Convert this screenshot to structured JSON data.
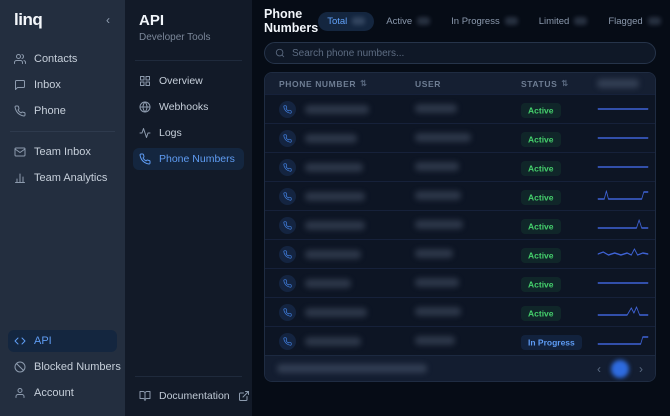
{
  "brand": {
    "logo": "linq"
  },
  "icons": {
    "collapse": "‹",
    "sort": "⇅",
    "prev": "‹",
    "next": "›"
  },
  "left_sidebar": {
    "items": [
      {
        "label": "Contacts"
      },
      {
        "label": "Inbox"
      },
      {
        "label": "Phone"
      }
    ],
    "team_items": [
      {
        "label": "Team Inbox"
      },
      {
        "label": "Team Analytics"
      }
    ],
    "bottom_items": [
      {
        "label": "API",
        "active": true
      },
      {
        "label": "Blocked Numbers"
      },
      {
        "label": "Account"
      }
    ]
  },
  "sub_sidebar": {
    "title": "API",
    "subtitle": "Developer Tools",
    "items": [
      {
        "label": "Overview"
      },
      {
        "label": "Webhooks"
      },
      {
        "label": "Logs"
      },
      {
        "label": "Phone Numbers",
        "active": true
      }
    ],
    "footer": {
      "label": "Documentation"
    }
  },
  "main": {
    "title": "Phone Numbers",
    "tabs": [
      {
        "label": "Total",
        "active": true
      },
      {
        "label": "Active",
        "active": false
      },
      {
        "label": "In Progress",
        "active": false
      },
      {
        "label": "Limited",
        "active": false
      },
      {
        "label": "Flagged",
        "active": false
      }
    ],
    "search": {
      "placeholder": "Search phone numbers..."
    },
    "table": {
      "columns": [
        {
          "label": "PHONE NUMBER",
          "sortable": true
        },
        {
          "label": "USER",
          "sortable": false
        },
        {
          "label": "STATUS",
          "sortable": true
        },
        {
          "label": "",
          "redacted": true
        }
      ],
      "rows": [
        {
          "status": "Active",
          "spark": [
            [
              2,
              8
            ],
            [
              98,
              8
            ]
          ],
          "pw": 64,
          "uw": 42
        },
        {
          "status": "Active",
          "spark": [
            [
              2,
              8
            ],
            [
              98,
              8
            ]
          ],
          "pw": 52,
          "uw": 56
        },
        {
          "status": "Active",
          "spark": [
            [
              2,
              8
            ],
            [
              98,
              8
            ]
          ],
          "pw": 58,
          "uw": 44
        },
        {
          "status": "Active",
          "spark": [
            [
              2,
              11
            ],
            [
              14,
              11
            ],
            [
              18,
              3
            ],
            [
              22,
              11
            ],
            [
              86,
              11
            ],
            [
              90,
              4
            ],
            [
              98,
              4
            ]
          ],
          "pw": 60,
          "uw": 46
        },
        {
          "status": "Active",
          "spark": [
            [
              2,
              11
            ],
            [
              76,
              11
            ],
            [
              81,
              3
            ],
            [
              86,
              11
            ],
            [
              98,
              11
            ]
          ],
          "pw": 60,
          "uw": 48
        },
        {
          "status": "Active",
          "spark": [
            [
              2,
              8
            ],
            [
              12,
              6
            ],
            [
              22,
              9
            ],
            [
              34,
              7
            ],
            [
              46,
              9
            ],
            [
              58,
              7
            ],
            [
              66,
              9
            ],
            [
              72,
              3
            ],
            [
              78,
              9
            ],
            [
              88,
              7
            ],
            [
              98,
              8
            ]
          ],
          "pw": 56,
          "uw": 38
        },
        {
          "status": "Active",
          "spark": [
            [
              2,
              8
            ],
            [
              98,
              8
            ]
          ],
          "pw": 46,
          "uw": 44
        },
        {
          "status": "Active",
          "spark": [
            [
              2,
              11
            ],
            [
              58,
              11
            ],
            [
              66,
              4
            ],
            [
              71,
              9
            ],
            [
              76,
              3
            ],
            [
              82,
              11
            ],
            [
              98,
              11
            ]
          ],
          "pw": 62,
          "uw": 46
        },
        {
          "status": "In Progress",
          "spark": [
            [
              2,
              11
            ],
            [
              84,
              11
            ],
            [
              88,
              4
            ],
            [
              98,
              4
            ]
          ],
          "pw": 56,
          "uw": 40
        }
      ]
    },
    "pagination": {
      "current_page_redacted": true
    }
  },
  "colors": {
    "accent": "#3b82f6",
    "sparkline": "#3f63d6",
    "status_active": "#45d06c",
    "status_in_progress": "#5e9cf5"
  }
}
